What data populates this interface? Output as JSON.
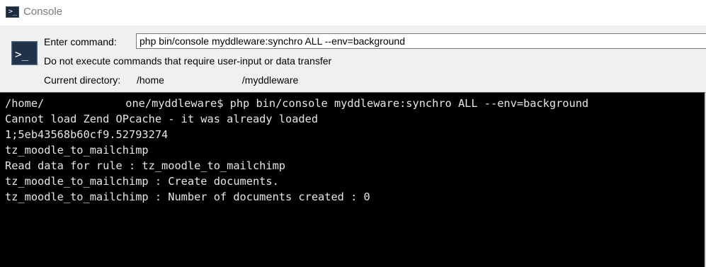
{
  "window": {
    "title": "Console",
    "icon": "console-icon"
  },
  "panel": {
    "icon": "terminal-icon",
    "enter_command_label": "Enter command:",
    "command_value": "php bin/console myddleware:synchro ALL --env=background",
    "note": "Do not execute commands that require user-input or data transfer",
    "current_directory_label": "Current directory:",
    "current_directory_prefix": "/home",
    "current_directory_suffix": "/myddleware"
  },
  "terminal": {
    "prompt_prefix": "/home/",
    "prompt_suffix": "one/myddleware$ php bin/console myddleware:synchro ALL --env=background",
    "lines": [
      "Cannot load Zend OPcache - it was already loaded",
      "1;5eb43568b60cf9.52793274",
      "tz_moodle_to_mailchimp",
      "Read data for rule : tz_moodle_to_mailchimp",
      "tz_moodle_to_mailchimp : Create documents.",
      "tz_moodle_to_mailchimp : Number of documents created : 0"
    ]
  }
}
